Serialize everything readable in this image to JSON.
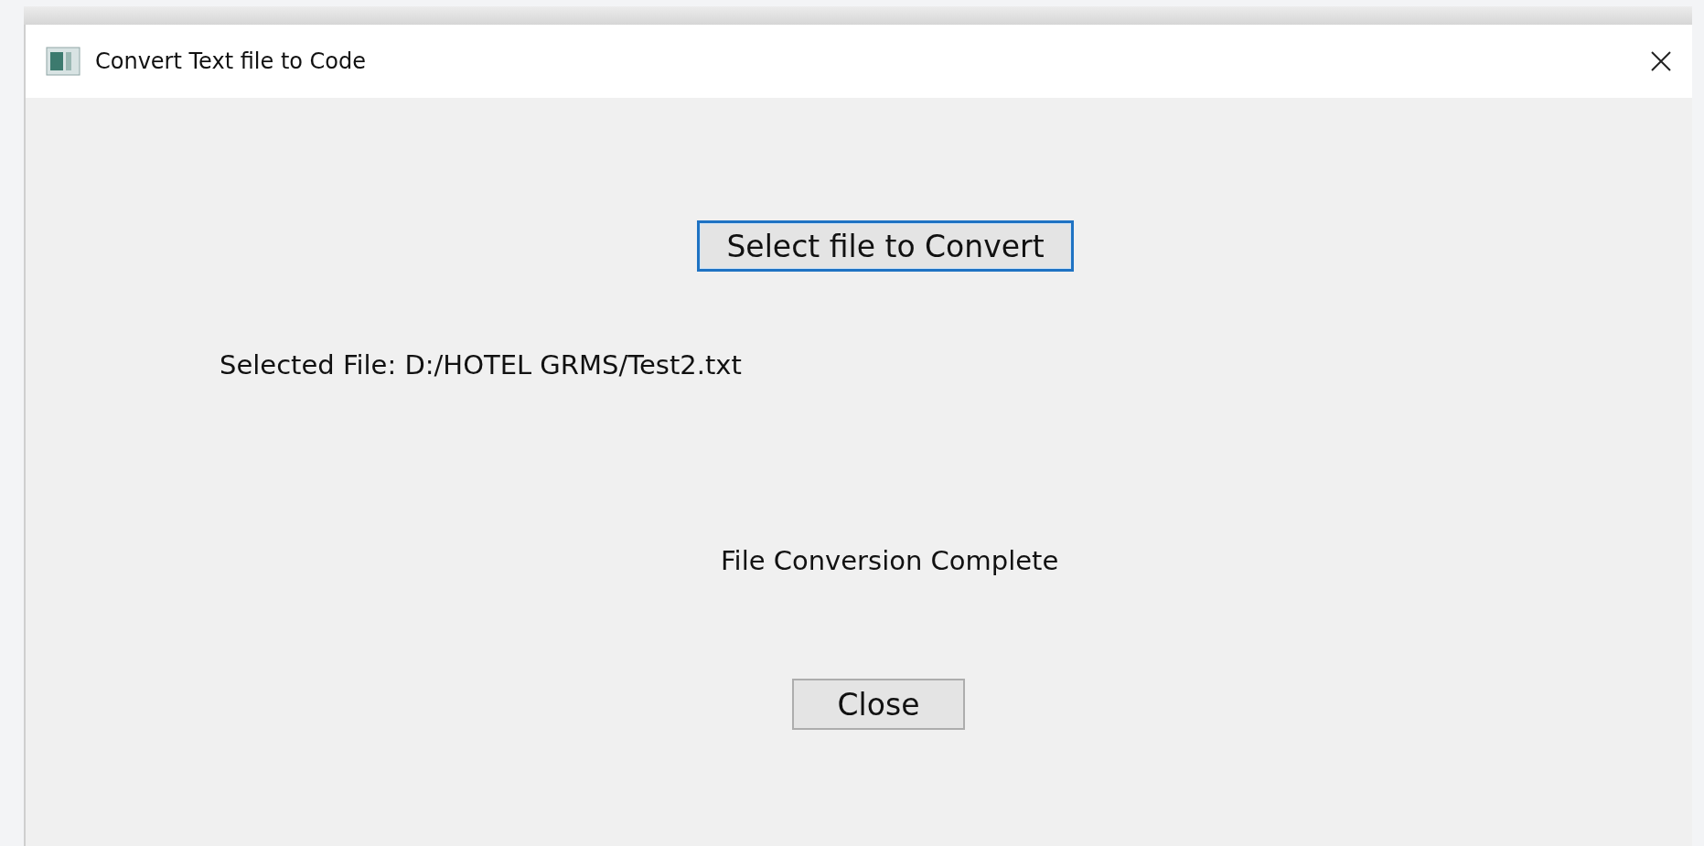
{
  "window": {
    "title": "Convert Text file to Code"
  },
  "select_button": {
    "label": "Select file to Convert",
    "focused": true
  },
  "selected_file": "Selected File: D:/HOTEL GRMS/Test2.txt",
  "status": "File Conversion Complete",
  "close_button": {
    "label": "Close",
    "focused": false
  }
}
